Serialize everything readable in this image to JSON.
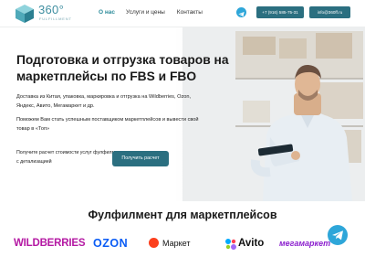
{
  "header": {
    "logo_text": "360°",
    "logo_sub": "FULFILLMENT",
    "nav": [
      {
        "label": "О нас"
      },
      {
        "label": "Услуги и цены"
      },
      {
        "label": "Контакты"
      }
    ],
    "phone": "+7 (916) 585-75-31",
    "email": "info@360ff.ru"
  },
  "hero": {
    "title": "Подготовка и отгрузка товаров на маркетплейсы по FBS и FBO",
    "paragraph1": "Доставка из Китая, упаковка, маркировка и отгрузка на Wildberries, Ozon, Яндекс, Авито, Мегамаркет и др.",
    "paragraph2": "Поможем Вам стать успешным поставщиком маркетплейсов и вывести свой товар в «Топ»",
    "cta_text": "Получите расчет стоимости услуг фулфилмента с детализацией",
    "cta_button": "Получить расчет"
  },
  "marketplaces": {
    "title": "Фулфилмент для маркетплейсов",
    "brands": {
      "wildberries": "WILDBERRIES",
      "ozon": "OZON",
      "yandex": "Маркет",
      "avito": "Avito",
      "megamarket": "мегамаркет"
    }
  },
  "colors": {
    "accent": "#2b6f80",
    "nav_active": "#2a8a99",
    "telegram": "#2ea6d9",
    "wildberries": "#b419a3",
    "ozon": "#0a5cf5",
    "megamarket": "#8c21ce"
  },
  "icons": {
    "telegram": "telegram-icon",
    "logo": "cube-logo-icon"
  }
}
